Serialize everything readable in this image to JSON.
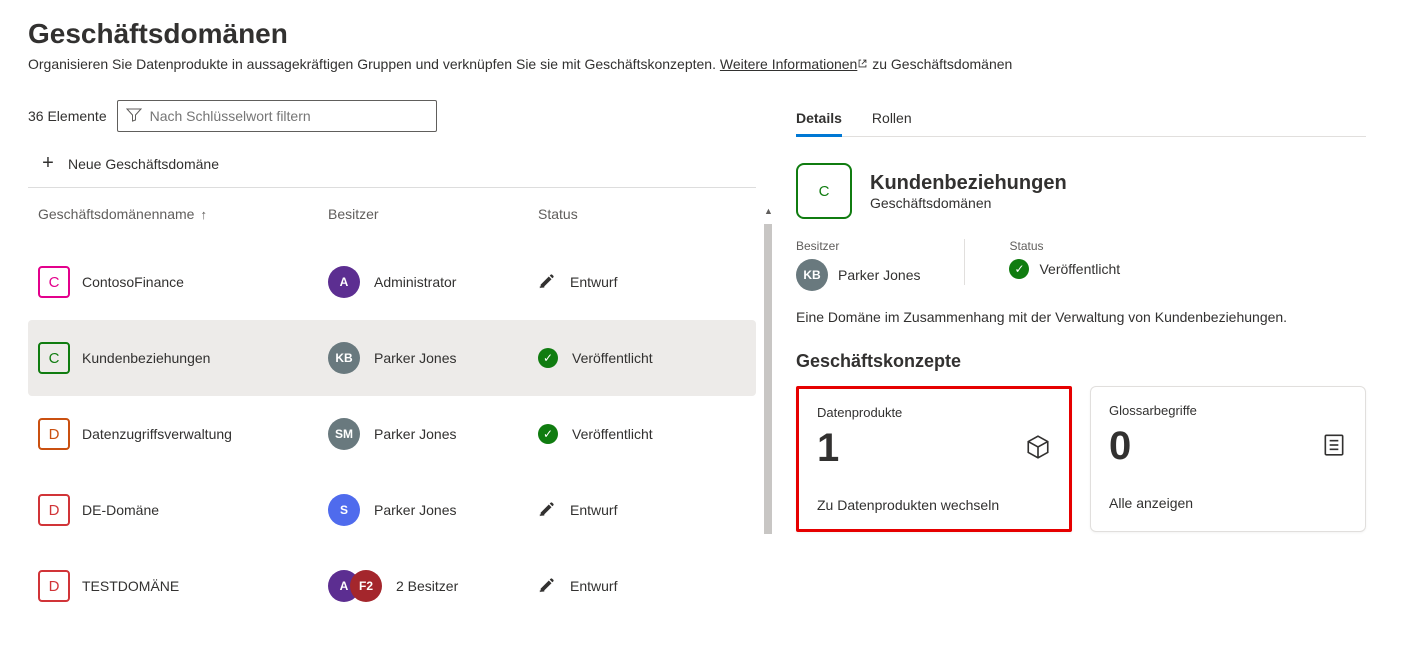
{
  "header": {
    "title": "Geschäftsdomänen",
    "subtitle_prefix": "Organisieren Sie Datenprodukte in aussagekräftigen Gruppen und verknüpfen Sie sie mit Geschäftskonzepten. ",
    "learn_more_label": "Weitere Informationen",
    "subtitle_suffix": " zu Geschäftsdomänen"
  },
  "filter": {
    "count_label": "36 Elemente",
    "placeholder": "Nach Schlüsselwort filtern"
  },
  "new_domain_label": "Neue Geschäftsdomäne",
  "columns": {
    "name": "Geschäftsdomänenname",
    "owner": "Besitzer",
    "status": "Status"
  },
  "rows": [
    {
      "tile_letter": "C",
      "tile_class": "tile-pink",
      "name": "ContosoFinance",
      "avatar_text": "A",
      "avatar_class": "avatar-purple",
      "owner": "Administrator",
      "status_type": "draft",
      "status_label": "Entwurf",
      "selected": false
    },
    {
      "tile_letter": "C",
      "tile_class": "tile-green",
      "name": "Kundenbeziehungen",
      "avatar_text": "KB",
      "avatar_class": "avatar-gray",
      "owner": "Parker Jones",
      "status_type": "published",
      "status_label": "Veröffentlicht",
      "selected": true
    },
    {
      "tile_letter": "D",
      "tile_class": "tile-orange",
      "name": "Datenzugriffsverwaltung",
      "avatar_text": "SM",
      "avatar_class": "avatar-gray",
      "owner": "Parker Jones",
      "status_type": "published",
      "status_label": "Veröffentlicht",
      "selected": false
    },
    {
      "tile_letter": "D",
      "tile_class": "tile-red",
      "name": "DE-Domäne",
      "avatar_text": "S",
      "avatar_class": "avatar-blue",
      "owner": "Parker Jones",
      "status_type": "draft",
      "status_label": "Entwurf",
      "selected": false
    },
    {
      "tile_letter": "D",
      "tile_class": "tile-red",
      "name": "TESTDOMÄNE",
      "avatar_text": "A",
      "avatar_class": "avatar-purple",
      "avatar2_text": "F2",
      "avatar2_class": "avatar-maroon",
      "owner": "2 Besitzer",
      "status_type": "draft",
      "status_label": "Entwurf",
      "selected": false
    }
  ],
  "detail": {
    "tabs": {
      "details": "Details",
      "roles": "Rollen"
    },
    "tile_letter": "C",
    "title": "Kundenbeziehungen",
    "subtitle": "Geschäftsdomänen",
    "owner_label": "Besitzer",
    "owner_avatar": "KB",
    "owner_name": "Parker Jones",
    "status_label": "Status",
    "status_value": "Veröffentlicht",
    "description": "Eine Domäne im Zusammenhang mit der Verwaltung von Kundenbeziehungen.",
    "concepts_heading": "Geschäftskonzepte",
    "cards": [
      {
        "label": "Datenprodukte",
        "count": "1",
        "icon": "cube",
        "link": "Zu Datenprodukten wechseln",
        "highlight": true
      },
      {
        "label": "Glossarbegriffe",
        "count": "0",
        "icon": "list",
        "link": "Alle anzeigen",
        "highlight": false
      }
    ]
  }
}
